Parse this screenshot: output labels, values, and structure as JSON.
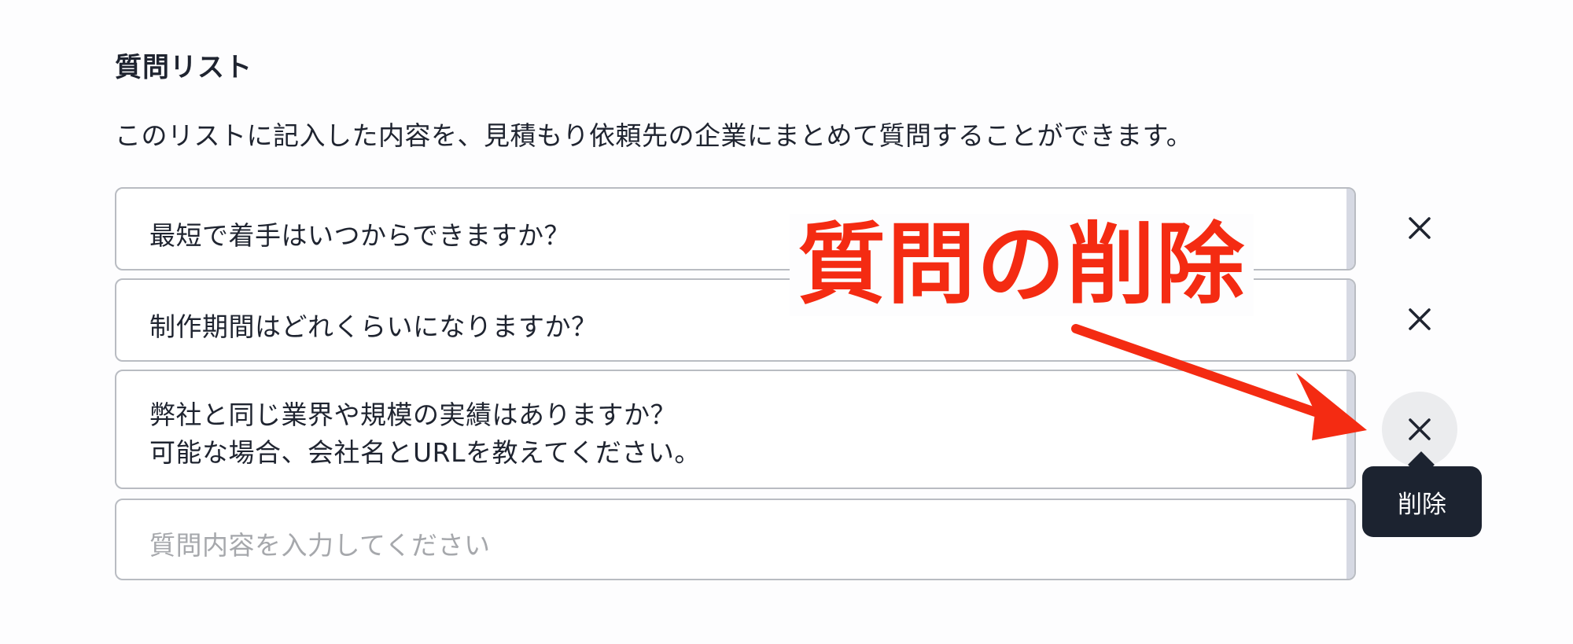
{
  "section": {
    "title": "質問リスト",
    "description": "このリストに記入した内容を、見積もり依頼先の企業にまとめて質問することができます。"
  },
  "questions": [
    {
      "text": "最短で着手はいつからできますか？"
    },
    {
      "text": "制作期間はどれくらいになりますか？"
    },
    {
      "text": "弊社と同じ業界や規模の実績はありますか？\n可能な場合、会社名とURLを教えてください。"
    }
  ],
  "new_question": {
    "placeholder": "質問内容を入力してください"
  },
  "tooltip": {
    "label": "削除"
  },
  "annotation": {
    "label": "質問の削除",
    "color": "#f42b12"
  },
  "icons": {
    "delete": "close-icon"
  }
}
